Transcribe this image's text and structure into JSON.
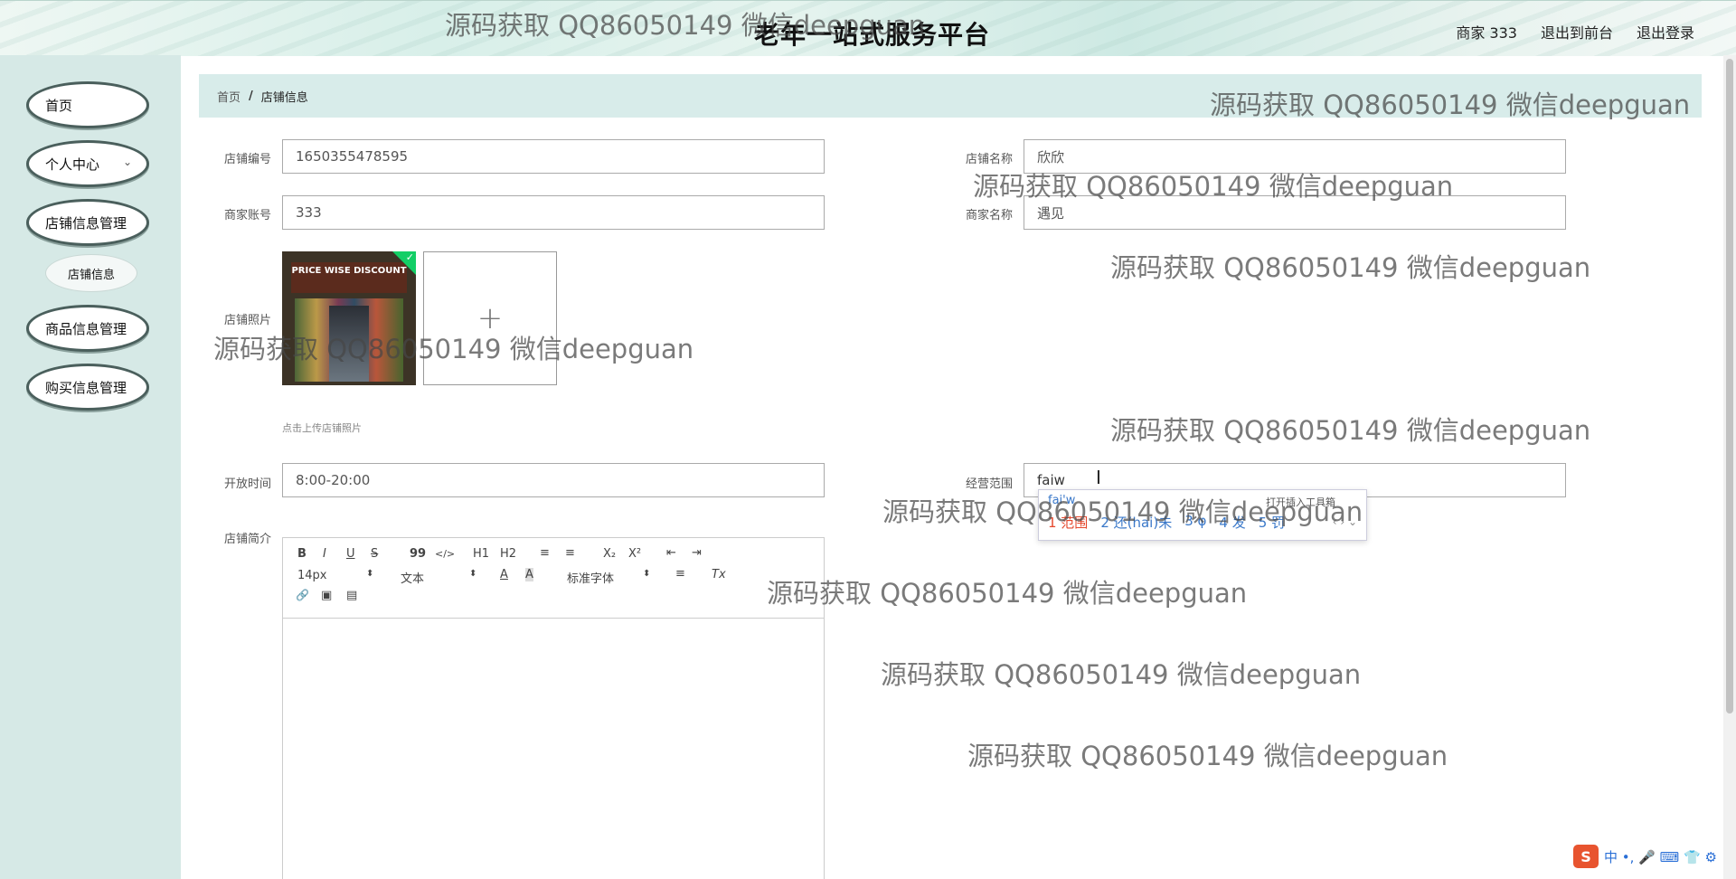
{
  "header": {
    "title": "老年一站式服务平台",
    "user_label": "商家 333",
    "to_front": "退出到前台",
    "logout": "退出登录"
  },
  "sidebar": {
    "items": [
      {
        "label": "首页"
      },
      {
        "label": "个人中心"
      },
      {
        "label": "店铺信息管理"
      },
      {
        "label": "店铺信息"
      },
      {
        "label": "商品信息管理"
      },
      {
        "label": "购买信息管理"
      }
    ]
  },
  "breadcrumb": {
    "home": "首页",
    "sep": "/",
    "current": "店铺信息"
  },
  "form": {
    "shop_no_label": "店铺编号",
    "shop_no": "1650355478595",
    "shop_name_label": "店铺名称",
    "shop_name": "欣欣",
    "merchant_account_label": "商家账号",
    "merchant_account": "333",
    "merchant_name_label": "商家名称",
    "merchant_name": "遇见",
    "photo_label": "店铺照片",
    "photo_sign": "PRICE WISE DISCOUNT",
    "upload_plus": "+",
    "upload_hint": "点击上传店铺照片",
    "hours_label": "开放时间",
    "hours": "8:00-20:00",
    "scope_label": "经营范围",
    "scope": "faiw",
    "intro_label": "店铺简介"
  },
  "editor": {
    "bold": "B",
    "italic": "I",
    "underline": "U",
    "strike": "S",
    "quote": "99",
    "code": "</>",
    "h1": "H1",
    "h2": "H2",
    "ol": "≡",
    "ul": "≡",
    "sub": "X₂",
    "sup": "X²",
    "outdent": "⇤",
    "indent": "⇥",
    "size": "14px",
    "format": "文本",
    "font": "标准字体",
    "color": "A",
    "bg": "A",
    "align": "≡",
    "clean": "Tx",
    "link": "🔗",
    "image": "▣",
    "video": "▤"
  },
  "ime": {
    "composition": "fai'w",
    "tool": "打开插入工具箱",
    "cand1": "1 范围",
    "cand2": "2 还(hai)未",
    "cand3": "3 φ",
    "cand4": "4 发",
    "cand5": "5 罚",
    "nav": "‹ › ⌄"
  },
  "tray": {
    "logo": "S",
    "text": "中 •, 🎤 ⌨ 👕 ⚙"
  },
  "watermark": "源码获取 QQ86050149 微信deepguan",
  "colors": {
    "sidebar_bg": "#d6e9e6",
    "crumb_bg": "#d8ecea",
    "menu_border": "#4a5f5c",
    "check": "#13ce66"
  }
}
